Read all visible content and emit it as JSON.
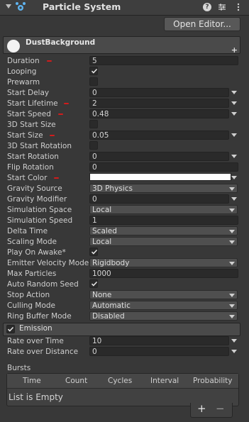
{
  "header": {
    "title": "Particle System",
    "help_glyph": "?"
  },
  "toolbar": {
    "open_editor_label": "Open Editor..."
  },
  "main_module": {
    "name": "DustBackground"
  },
  "props": {
    "duration": {
      "label": "Duration",
      "value": "5"
    },
    "looping": {
      "label": "Looping",
      "checked": true
    },
    "prewarm": {
      "label": "Prewarm",
      "checked": false
    },
    "start_delay": {
      "label": "Start Delay",
      "value": "0"
    },
    "start_lifetime": {
      "label": "Start Lifetime",
      "value": "2"
    },
    "start_speed": {
      "label": "Start Speed",
      "value": "0.48"
    },
    "start_size_3d": {
      "label": "3D Start Size",
      "checked": false
    },
    "start_size": {
      "label": "Start Size",
      "value": "0.05"
    },
    "start_rotation_3d": {
      "label": "3D Start Rotation",
      "checked": false
    },
    "start_rotation": {
      "label": "Start Rotation",
      "value": "0"
    },
    "flip_rotation": {
      "label": "Flip Rotation",
      "value": "0"
    },
    "start_color": {
      "label": "Start Color",
      "color": "#ffffff"
    },
    "gravity_source": {
      "label": "Gravity Source",
      "value": "3D Physics"
    },
    "gravity_modifier": {
      "label": "Gravity Modifier",
      "value": "0"
    },
    "simulation_space": {
      "label": "Simulation Space",
      "value": "Local"
    },
    "simulation_speed": {
      "label": "Simulation Speed",
      "value": "1"
    },
    "delta_time": {
      "label": "Delta Time",
      "value": "Scaled"
    },
    "scaling_mode": {
      "label": "Scaling Mode",
      "value": "Local"
    },
    "play_on_awake": {
      "label": "Play On Awake*",
      "checked": true
    },
    "emitter_velocity_mode": {
      "label": "Emitter Velocity Mode",
      "value": "Rigidbody"
    },
    "max_particles": {
      "label": "Max Particles",
      "value": "1000"
    },
    "auto_random_seed": {
      "label": "Auto Random Seed",
      "checked": true
    },
    "stop_action": {
      "label": "Stop Action",
      "value": "None"
    },
    "culling_mode": {
      "label": "Culling Mode",
      "value": "Automatic"
    },
    "ring_buffer_mode": {
      "label": "Ring Buffer Mode",
      "value": "Disabled"
    }
  },
  "emission": {
    "name": "Emission",
    "enabled": true,
    "rate_over_time": {
      "label": "Rate over Time",
      "value": "10"
    },
    "rate_over_distance": {
      "label": "Rate over Distance",
      "value": "0"
    },
    "bursts": {
      "label": "Bursts",
      "columns": [
        "Time",
        "Count",
        "Cycles",
        "Interval",
        "Probability"
      ],
      "empty_text": "List is Empty",
      "add_glyph": "+",
      "remove_glyph": "−"
    }
  },
  "annotation_color": "#d11c1c"
}
